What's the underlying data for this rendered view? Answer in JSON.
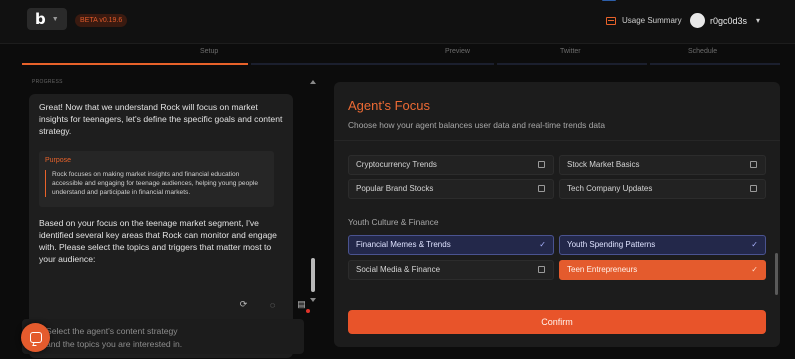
{
  "header": {
    "logo_letter": "b",
    "beta_badge": "BETA v0.19.6",
    "usage_summary": "Usage Summary",
    "username": "r0gc0d3s"
  },
  "steps": [
    "Setup",
    "Preview",
    "Twitter",
    "Schedule"
  ],
  "chat": {
    "tag": "PROGRESS",
    "intro": "Great! Now that we understand Rock will focus on market insights for teenagers, let's define the specific goals and content strategy.",
    "purpose_title": "Purpose",
    "purpose_body": "Rock focuses on making market insights and financial education accessible and engaging for teenage audiences, helping young people understand and participate in financial markets.",
    "followup": "Based on your focus on the teenage market segment, I've identified several key areas that Rock can monitor and engage with. Please select the topics and triggers that matter most to your audience:",
    "input_placeholder_line1": "Select the agent's content strategy",
    "input_placeholder_line2": "and the topics you are interested in."
  },
  "panel": {
    "title": "Agent's Focus",
    "subtitle": "Choose how your agent balances user data and real-time trends data",
    "options_top": [
      {
        "label": "Cryptocurrency Trends",
        "selected": false
      },
      {
        "label": "Stock Market Basics",
        "selected": false
      },
      {
        "label": "Popular Brand Stocks",
        "selected": false
      },
      {
        "label": "Tech Company Updates",
        "selected": false
      }
    ],
    "group_label": "Youth Culture & Finance",
    "options_group": [
      {
        "label": "Financial Memes & Trends",
        "selected": true
      },
      {
        "label": "Youth Spending Patterns",
        "selected": true
      },
      {
        "label": "Social Media & Finance",
        "selected": false
      },
      {
        "label": "Teen Entrepreneurs",
        "selected": true
      }
    ],
    "confirm_label": "Confirm"
  },
  "icons": {
    "check": "✓",
    "refresh": "⟳",
    "comment": "◌",
    "doc": "▤"
  },
  "colors": {
    "accent": "#e8622a",
    "selected_blue": "#23284a",
    "selected_orange": "#e45b2d",
    "panel_bg": "#1c1c1c"
  }
}
